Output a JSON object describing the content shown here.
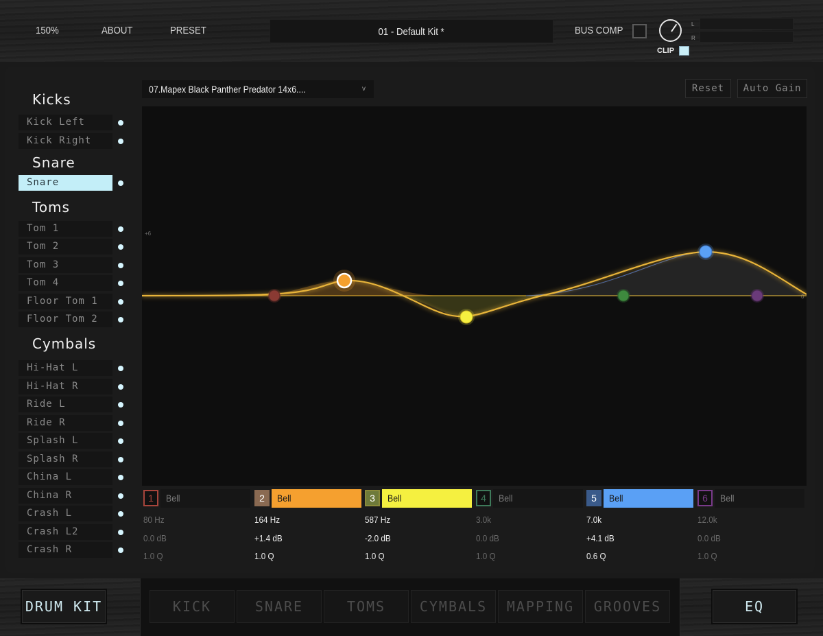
{
  "topbar": {
    "zoom": "150%",
    "about": "ABOUT",
    "preset": "PRESET",
    "kit_name": "01 - Default Kit *",
    "bus_comp": "BUS COMP",
    "bus_comp_checked": false,
    "clip": "CLIP",
    "meter_left": "L",
    "meter_right": "R"
  },
  "sidebar": {
    "groups": [
      {
        "title": "Kicks",
        "tracks": [
          "Kick Left",
          "Kick Right"
        ]
      },
      {
        "title": "Snare",
        "tracks": [
          "Snare"
        ]
      },
      {
        "title": "Toms",
        "tracks": [
          "Tom 1",
          "Tom 2",
          "Tom 3",
          "Tom 4",
          "Floor Tom 1",
          "Floor Tom 2"
        ]
      },
      {
        "title": "Cymbals",
        "tracks": [
          "Hi-Hat L",
          "Hi-Hat R",
          "Ride L",
          "Ride R",
          "Splash L",
          "Splash R",
          "China L",
          "China R",
          "Crash L",
          "Crash L2",
          "Crash R"
        ]
      }
    ],
    "selected_track": "Snare"
  },
  "eq": {
    "instrument": "07.Mapex Black Panther Predator 14x6....",
    "dropdown_arrow": "v",
    "reset": "Reset",
    "auto_gain": "Auto Gain",
    "db_label_top": "+6",
    "db_label_zero": "0",
    "bands": [
      {
        "num": "1",
        "type": "Bell",
        "freq": "80 Hz",
        "gain": "0.0 dB",
        "q": "1.0 Q",
        "enabled": false,
        "color": "#a8453c"
      },
      {
        "num": "2",
        "type": "Bell",
        "freq": "164 Hz",
        "gain": "+1.4 dB",
        "q": "1.0 Q",
        "enabled": true,
        "color": "#f5a02f"
      },
      {
        "num": "3",
        "type": "Bell",
        "freq": "587 Hz",
        "gain": "-2.0 dB",
        "q": "1.0 Q",
        "enabled": true,
        "color": "#f5f040"
      },
      {
        "num": "4",
        "type": "Bell",
        "freq": "3.0k",
        "gain": "0.0 dB",
        "q": "1.0 Q",
        "enabled": false,
        "color": "#3e8a3e"
      },
      {
        "num": "5",
        "type": "Bell",
        "freq": "7.0k",
        "gain": "+4.1 dB",
        "q": "0.6 Q",
        "enabled": true,
        "color": "#5aa0f5"
      },
      {
        "num": "6",
        "type": "Bell",
        "freq": "12.0k",
        "gain": "0.0 dB",
        "q": "1.0 Q",
        "enabled": false,
        "color": "#7a3a8a"
      }
    ],
    "curve_color": "#e8b43a"
  },
  "bottom_nav": {
    "drum_kit": "DRUM KIT",
    "tabs": [
      "KICK",
      "SNARE",
      "TOMS",
      "CYMBALS",
      "MAPPING",
      "GROOVES"
    ],
    "eq": "EQ"
  }
}
